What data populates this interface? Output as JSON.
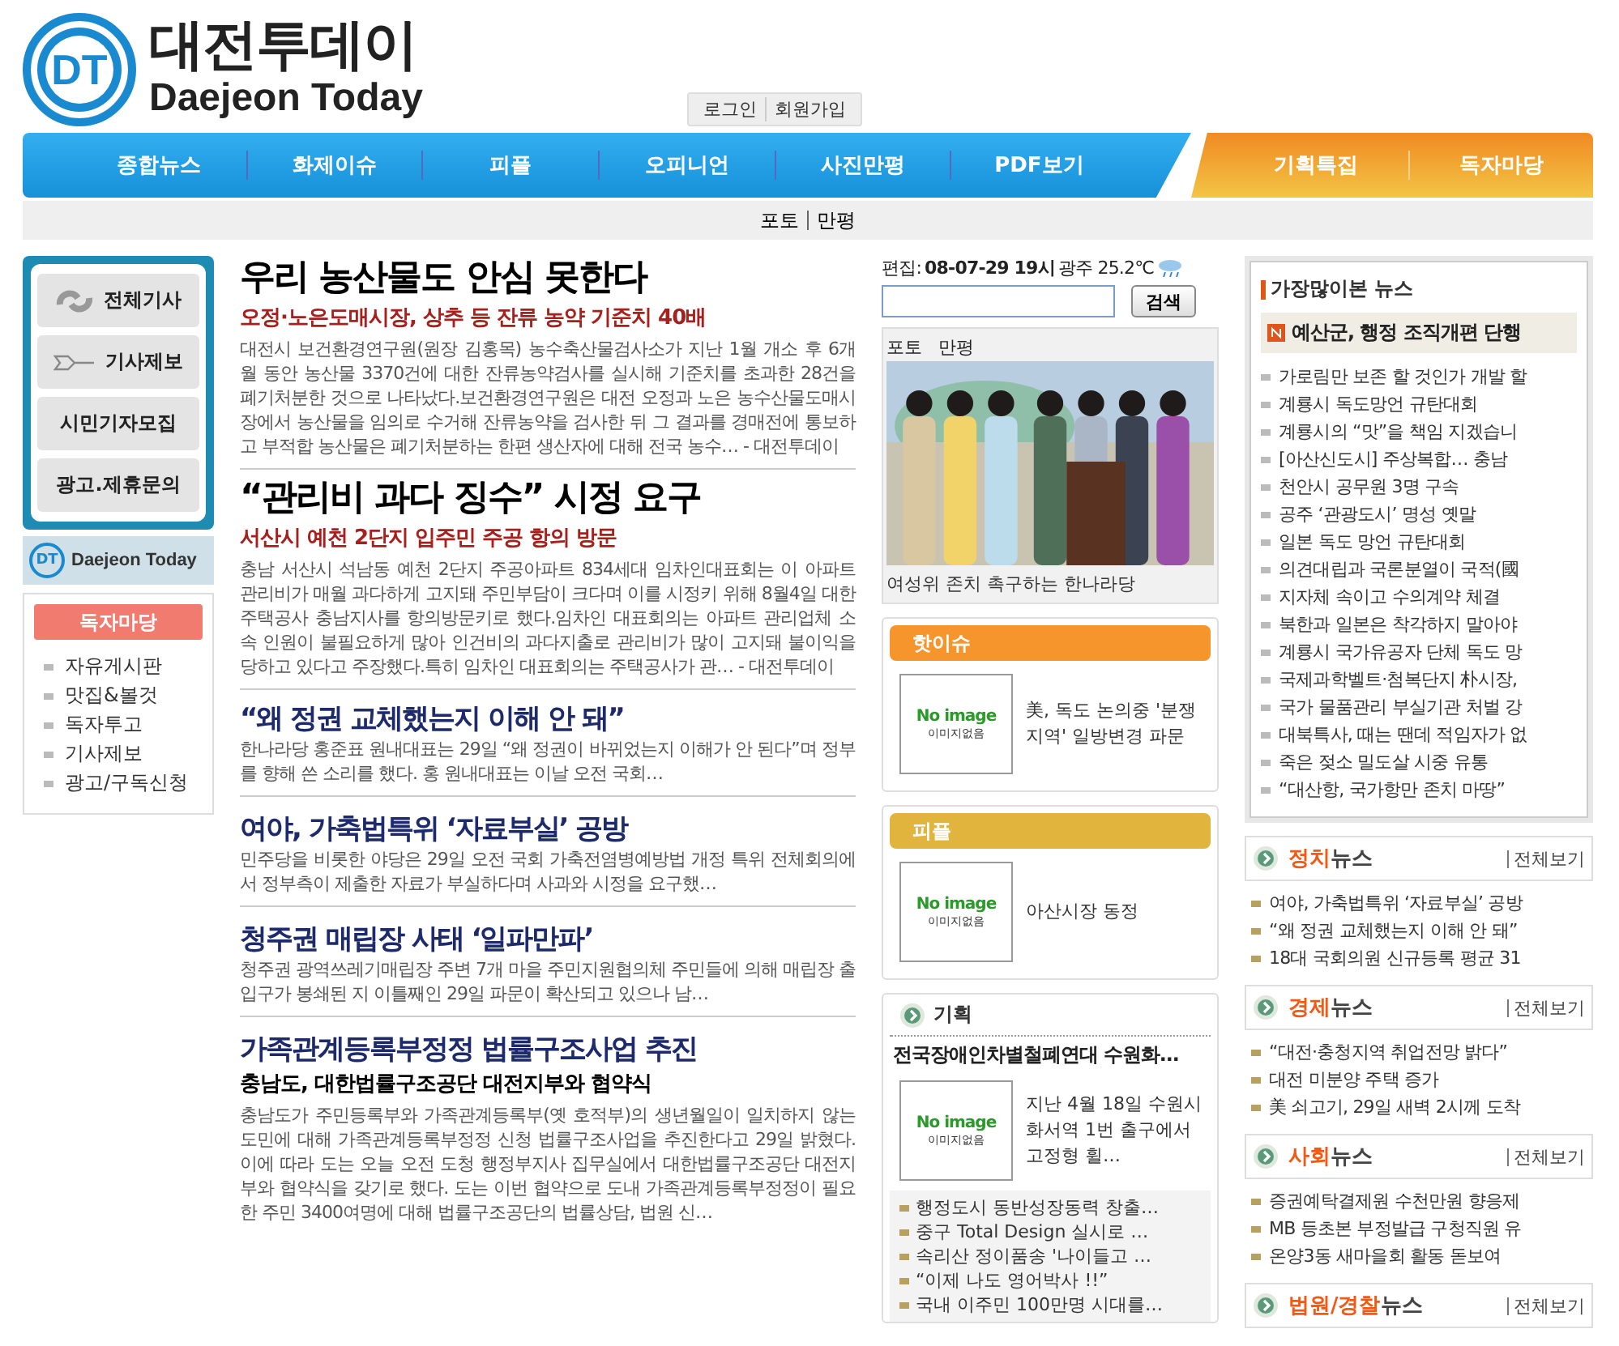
{
  "logo": {
    "mark": "DT",
    "korean": "대전투데이",
    "english": "Daejeon Today"
  },
  "account_links": [
    "로그인",
    "회원가입"
  ],
  "nav": {
    "main": [
      "종합뉴스",
      "화제이슈",
      "피플",
      "오피니언",
      "사진만평",
      "PDF보기"
    ],
    "featured": [
      "기획특집",
      "독자마당"
    ]
  },
  "subnav": [
    "포토",
    "만평"
  ],
  "left_sidebar": {
    "buttons": [
      {
        "label": "전체기사",
        "kind": "arrows"
      },
      {
        "label": "기사제보",
        "kind": "pen"
      },
      {
        "label": "시민기자모집",
        "kind": "plain"
      },
      {
        "label": "광고.제휴문의",
        "kind": "plain"
      }
    ],
    "banner": {
      "mark": "DT",
      "text": "Daejeon Today"
    },
    "reader_corner": {
      "title": "독자마당",
      "items": [
        "자유게시판",
        "맛집&볼것",
        "독자투고",
        "기사제보",
        "광고/구독신청"
      ]
    }
  },
  "articles": [
    {
      "kind": "lead",
      "title": "우리 농산물도 안심 못한다",
      "subtitle": "오정·노은도매시장, 상추 등 잔류 농약 기준치 40배",
      "summary": "대전시 보건환경연구원(원장 김홍목) 농수축산물검사소가 지난 1월 개소 후 6개월 동안 농산물 3370건에 대한 잔류농약검사를 실시해 기준치를 초과한 28건을 폐기처분한 것으로 나타났다.보건환경연구원은 대전 오정과 노은 농수산물도매시장에서 농산물을 임의로 수거해 잔류농약을 검사한 뒤 그 결과를 경매전에 통보하고 부적합 농산물은 폐기처분하는 한편 생산자에 대해 전국 농수…",
      "source": "- 대전투데이"
    },
    {
      "kind": "lead",
      "title": "“관리비 과다 징수” 시정 요구",
      "subtitle": "서산시 예천 2단지 입주민 주공 항의 방문",
      "summary": "충남 서산시 석남동 예천 2단지 주공아파트 834세대 임차인대표회는 이 아파트 관리비가 매월 과다하게 고지돼 주민부담이 크다며 이를 시정키 위해 8월4일 대한주택공사 충남지사를 항의방문키로 했다.임차인 대표회의는 아파트 관리업체 소속 인원이 불필요하게 많아 인건비의 과다지출로 관리비가 많이 고지돼 불이익을 당하고 있다고 주장했다.특히 임차인 대표회의는 주택공사가 관…",
      "source": "- 대전투데이"
    },
    {
      "kind": "story",
      "title": "“왜 정권 교체했는지 이해 안 돼”",
      "summary": "한나라당 홍준표 원내대표는 29일 “왜 정권이 바뀌었는지 이해가 안 된다”며 정부를 향해 쓴 소리를 했다. 홍 원내대표는 이날 오전 국회…"
    },
    {
      "kind": "story",
      "title": "여야, 가축법특위 ‘자료부실’ 공방",
      "summary": "민주당을 비롯한 야당은 29일 오전 국회 가축전염병예방법 개정 특위 전체회의에서 정부측이 제출한 자료가 부실하다며 사과와 시정을 요구했…"
    },
    {
      "kind": "story",
      "title": "청주권 매립장 사태 ‘일파만파’",
      "summary": "청주권 광역쓰레기매립장 주변 7개 마을 주민지원협의체 주민들에 의해 매립장 출입구가 봉쇄된 지 이틀째인 29일 파문이 확산되고 있으나 남…"
    },
    {
      "kind": "story",
      "title": "가족관계등록부정정 법률구조사업 추진",
      "subtitle": "충남도, 대한법률구조공단 대전지부와 협약식",
      "summary": "충남도가 주민등록부와 가족관계등록부(옛 호적부)의 생년월일이 일치하지 않는 도민에 대해 가족관계등록부정정 신청 법률구조사업을 추진한다고 29일 밝혔다. 이에 따라 도는 오늘 오전 도청 행정부지사 집무실에서 대한법률구조공단 대전지부와 협약식을 갖기로 했다. 도는 이번 협약으로 도내 가족관계등록부정정이 필요한 주민 3400여명에 대해 법률구조공단의 법률상담, 법원 신…"
    }
  ],
  "edition": {
    "label": "편집:",
    "date": "08-07-29 19시",
    "weather": "광주 25.2℃"
  },
  "search": {
    "button": "검색"
  },
  "photo_box": {
    "tabs": [
      "포토",
      "만평"
    ],
    "caption": "여성위 존치 촉구하는 한나라당"
  },
  "cards": [
    {
      "kind": "hot",
      "title": "핫이슈",
      "image_text": "No image",
      "image_subtext": "이미지없음",
      "text": "美, 독도 논의중 '분쟁지역' 일방변경 파문"
    },
    {
      "kind": "people",
      "title": "피플",
      "image_text": "No image",
      "image_subtext": "이미지없음",
      "text": "아산시장 동정"
    }
  ],
  "planning": {
    "title": "기획",
    "headline": "전국장애인차별철폐연대 수원화…",
    "image_text": "No image",
    "image_subtext": "이미지없음",
    "summary": "지난 4월 18일 수원시 화서역 1번 출구에서 고정형 휠…",
    "items": [
      "행정도시 동반성장동력 창출…",
      "중구 Total Design 실시로 …",
      "속리산 정이품송 '나이들고 …",
      "“이제 나도 영어박사 !!”",
      "국내 이주민 100만명 시대를…"
    ]
  },
  "most_viewed": {
    "title": "가장많이본 뉴스",
    "top": "예산군, 행정 조직개편 단행",
    "items": [
      "가로림만 보존 할 것인가 개발 할",
      "계룡시 독도망언 규탄대회",
      "계룡시의 “맛”을 책임 지겠습니",
      "[아산신도시] 주상복합… 충남",
      "천안시 공무원 3명 구속",
      "공주 ‘관광도시’ 명성 옛말",
      "일본 독도 망언 규탄대회",
      "의견대립과 국론분열이 국적(國",
      "지자체 속이고 수의계약 체결",
      "북한과 일본은 착각하지 말아야",
      "계룡시 국가유공자 단체 독도 망",
      "국제과학벨트·첨복단지 朴시장,",
      "국가 물품관리 부실기관 처벌 강",
      "대북특사, 때는 땐데 적임자가 없",
      "죽은 젖소 밀도살 시중 유통",
      "“대산항, 국가항만 존치 마땅”"
    ]
  },
  "sections": [
    {
      "accent": "정치",
      "rest": "뉴스",
      "more": "전체보기",
      "items": [
        "여야, 가축법특위 ‘자료부실’ 공방",
        "“왜 정권 교체했는지 이해 안 돼”",
        "18대 국회의원 신규등록 평균 31"
      ]
    },
    {
      "accent": "경제",
      "rest": "뉴스",
      "more": "전체보기",
      "items": [
        "“대전·충청지역 취업전망 밝다”",
        "대전 미분양 주택 증가",
        "美 쇠고기, 29일 새벽 2시께 도착"
      ]
    },
    {
      "accent": "사회",
      "rest": "뉴스",
      "more": "전체보기",
      "items": [
        "증권예탁결제원 수천만원 향응제",
        "MB 등초본 부정발급 구청직원 유",
        "온양3동 새마을회 활동 돋보여"
      ]
    },
    {
      "accent": "법원/경찰",
      "rest": "뉴스",
      "more": "전체보기"
    }
  ]
}
